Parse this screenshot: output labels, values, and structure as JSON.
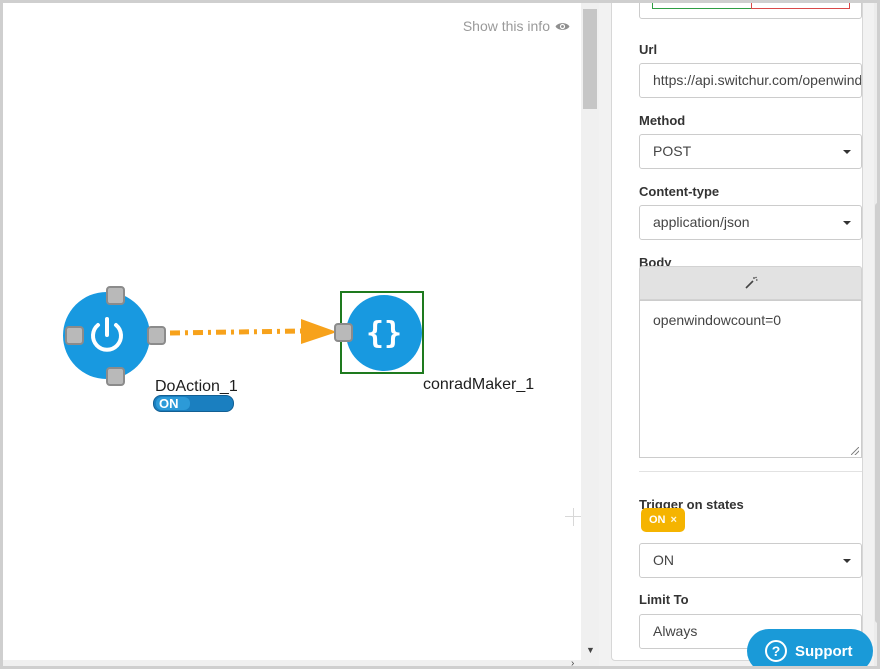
{
  "canvas": {
    "show_info_label": "Show this info",
    "nodes": [
      {
        "label": "DoAction_1",
        "state": "ON",
        "icon": "power-icon"
      },
      {
        "label": "conradMaker_1",
        "icon": "curly-braces-icon"
      }
    ],
    "connector_color": "#f7a21b",
    "node_color": "#1899e0"
  },
  "panel": {
    "url": {
      "label": "Url",
      "value": "https://api.switchur.com/openwindow"
    },
    "method": {
      "label": "Method",
      "value": "POST"
    },
    "content_type": {
      "label": "Content-type",
      "value": "application/json"
    },
    "body": {
      "label": "Body",
      "value": "openwindowcount=0",
      "wand_icon": "magic-wand-icon"
    },
    "trigger": {
      "label": "Trigger on states",
      "chip": "ON",
      "chip_remove": "×",
      "value": "ON"
    },
    "limit": {
      "label": "Limit To",
      "value": "Always"
    }
  },
  "support": {
    "label": "Support",
    "icon": "?"
  },
  "colors": {
    "accent": "#1a9ad8",
    "chip": "#f5b400",
    "selection": "#1e7a1e"
  }
}
